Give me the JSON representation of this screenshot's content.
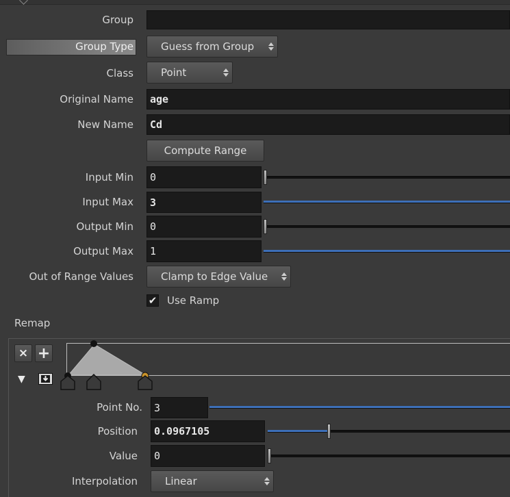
{
  "fields": {
    "group": {
      "label": "Group",
      "value": ""
    },
    "group_type": {
      "label": "Group Type",
      "value": "Guess from Group"
    },
    "class": {
      "label": "Class",
      "value": "Point"
    },
    "original_name": {
      "label": "Original Name",
      "value": "age"
    },
    "new_name": {
      "label": "New Name",
      "value": "Cd"
    },
    "compute_range": {
      "label": "Compute Range"
    },
    "input_min": {
      "label": "Input Min",
      "value": "0",
      "level": 0
    },
    "input_max": {
      "label": "Input Max",
      "value": "3",
      "level": 1
    },
    "output_min": {
      "label": "Output Min",
      "value": "0",
      "level": 0
    },
    "output_max": {
      "label": "Output Max",
      "value": "1",
      "level": 1
    },
    "out_of_range": {
      "label": "Out of Range Values",
      "value": "Clamp to Edge Value"
    },
    "use_ramp": {
      "label": "Use Ramp",
      "checked": true,
      "check_glyph": "✔"
    }
  },
  "remap": {
    "label": "Remap",
    "delete_glyph": "×",
    "add_glyph": "+",
    "collapse_glyph": "▼",
    "point_no": {
      "label": "Point No.",
      "value": "3"
    },
    "position": {
      "label": "Position",
      "value": "0.0967105",
      "level": 0.25
    },
    "value": {
      "label": "Value",
      "value": "0",
      "level": 0
    },
    "interpolation": {
      "label": "Interpolation",
      "value": "Linear"
    }
  },
  "colors": {
    "selected_key": "#c8922a",
    "slider_fill": "#3d6fb8"
  }
}
